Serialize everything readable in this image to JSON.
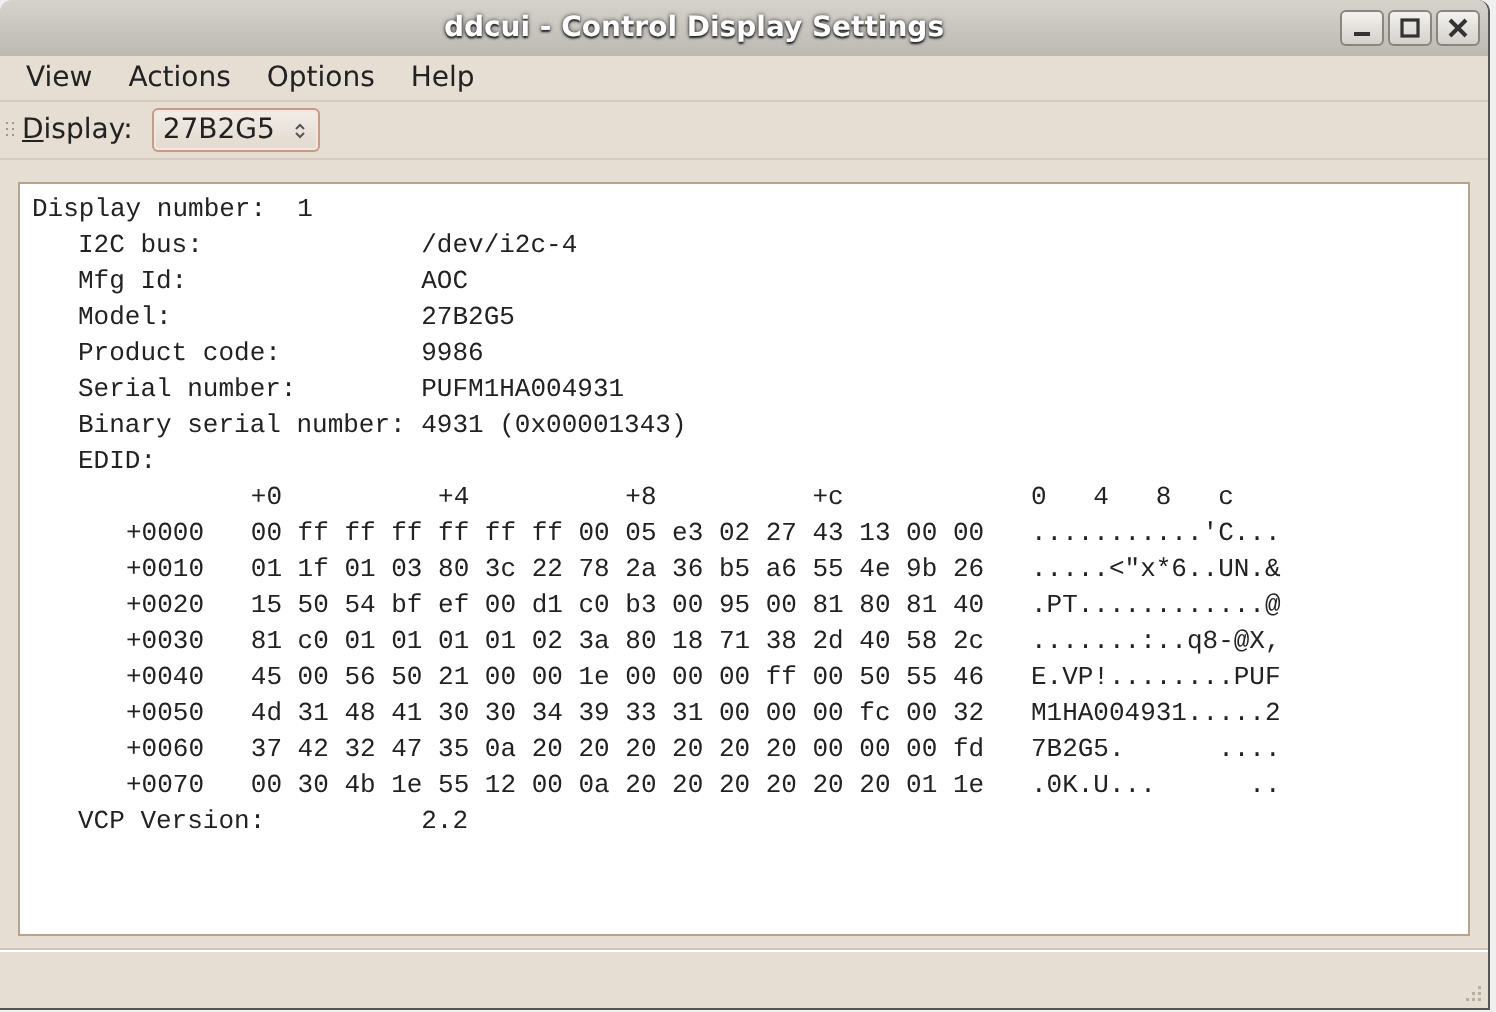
{
  "window": {
    "title": "ddcui - Control Display Settings"
  },
  "menu": [
    "View",
    "Actions",
    "Options",
    "Help"
  ],
  "toolbar": {
    "mnemonic": "D",
    "label_rest": "isplay:",
    "display": "27B2G5"
  },
  "report": {
    "display_label": "Display number:",
    "display_value": "1",
    "fields": [
      {
        "label": "I2C bus:",
        "value": "/dev/i2c-4"
      },
      {
        "label": "Mfg Id:",
        "value": "AOC"
      },
      {
        "label": "Model:",
        "value": "27B2G5"
      },
      {
        "label": "Product code:",
        "value": "9986"
      },
      {
        "label": "Serial number:",
        "value": "PUFM1HA004931"
      },
      {
        "label": "Binary serial number:",
        "value": "4931 (0x00001343)"
      },
      {
        "label": "EDID:"
      }
    ],
    "edid_header": "+0          +4          +8          +c",
    "ascii_header": "0   4   8   c",
    "edid_rows": [
      {
        "offset": "+0000",
        "bytes": "00 ff ff ff ff ff ff 00 05 e3 02 27 43 13 00 00",
        "ascii": "...........'C..."
      },
      {
        "offset": "+0010",
        "bytes": "01 1f 01 03 80 3c 22 78 2a 36 b5 a6 55 4e 9b 26",
        "ascii": ".....<\"x*6..UN.&"
      },
      {
        "offset": "+0020",
        "bytes": "15 50 54 bf ef 00 d1 c0 b3 00 95 00 81 80 81 40",
        "ascii": ".PT............@"
      },
      {
        "offset": "+0030",
        "bytes": "81 c0 01 01 01 01 02 3a 80 18 71 38 2d 40 58 2c",
        "ascii": ".......:..q8-@X,"
      },
      {
        "offset": "+0040",
        "bytes": "45 00 56 50 21 00 00 1e 00 00 00 ff 00 50 55 46",
        "ascii": "E.VP!........PUF"
      },
      {
        "offset": "+0050",
        "bytes": "4d 31 48 41 30 30 34 39 33 31 00 00 00 fc 00 32",
        "ascii": "M1HA004931.....2"
      },
      {
        "offset": "+0060",
        "bytes": "37 42 32 47 35 0a 20 20 20 20 20 20 00 00 00 fd",
        "ascii": "7B2G5.      ...."
      },
      {
        "offset": "+0070",
        "bytes": "00 30 4b 1e 55 12 00 0a 20 20 20 20 20 20 01 1e",
        "ascii": ".0K.U...      .."
      }
    ],
    "vcp_label": "VCP Version:",
    "vcp_value": "2.2"
  }
}
